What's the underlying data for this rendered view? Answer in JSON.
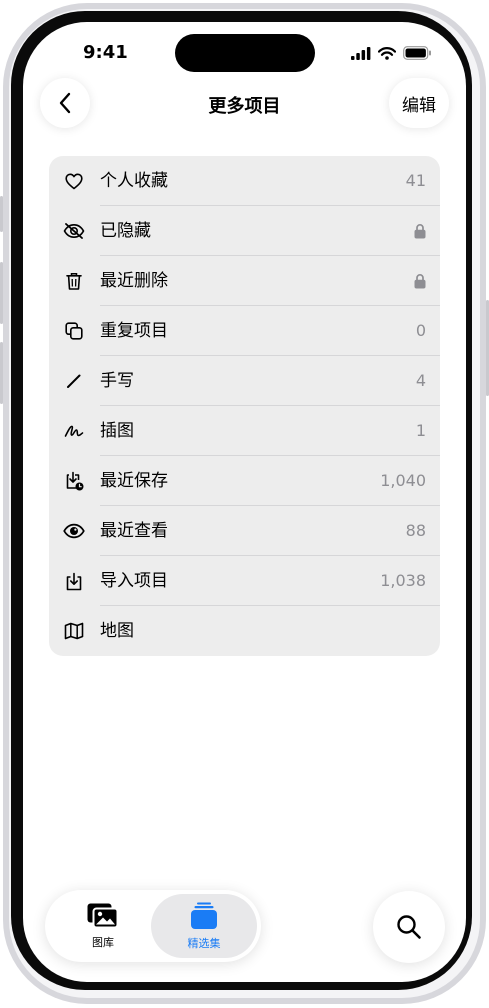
{
  "status": {
    "time": "9:41"
  },
  "nav": {
    "title": "更多项目",
    "edit_label": "编辑"
  },
  "items": [
    {
      "label": "个人收藏",
      "value": "41",
      "icon": "heart-icon"
    },
    {
      "label": "已隐藏",
      "value": "",
      "icon": "eye-slash-icon",
      "locked": true
    },
    {
      "label": "最近删除",
      "value": "",
      "icon": "trash-icon",
      "locked": true
    },
    {
      "label": "重复项目",
      "value": "0",
      "icon": "duplicate-icon"
    },
    {
      "label": "手写",
      "value": "4",
      "icon": "pencil-icon"
    },
    {
      "label": "插图",
      "value": "1",
      "icon": "scribble-icon"
    },
    {
      "label": "最近保存",
      "value": "1,040",
      "icon": "recently-saved-icon"
    },
    {
      "label": "最近查看",
      "value": "88",
      "icon": "eye-icon"
    },
    {
      "label": "导入项目",
      "value": "1,038",
      "icon": "import-icon"
    },
    {
      "label": "地图",
      "value": "",
      "icon": "map-icon"
    }
  ],
  "tabs": [
    {
      "label": "图库",
      "icon": "photos-library-icon",
      "selected": false
    },
    {
      "label": "精选集",
      "icon": "collections-icon",
      "selected": true
    }
  ],
  "colors": {
    "accent": "#1a7cf5",
    "card_bg": "#ededed",
    "value_gray": "#8e8e93"
  }
}
